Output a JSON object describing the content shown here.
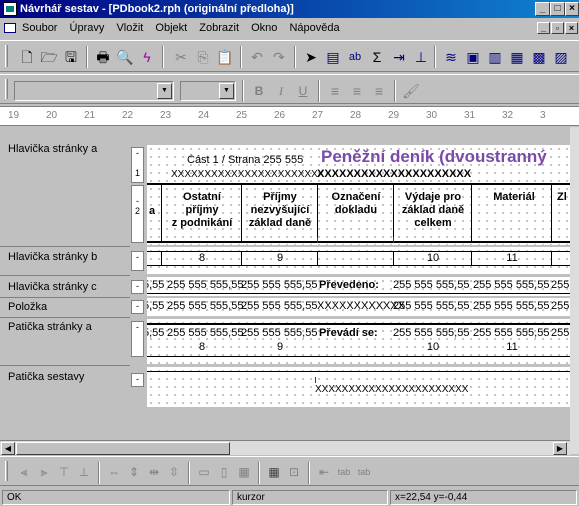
{
  "window": {
    "title": "Návrhář sestav - [PDbook2.rph (originální předloha)]",
    "minimize": "_",
    "maximize": "□",
    "close": "×",
    "mdi_min": "_",
    "mdi_restore": "▫",
    "mdi_close": "×"
  },
  "menu": [
    "Soubor",
    "Úpravy",
    "Vložit",
    "Objekt",
    "Zobrazit",
    "Okno",
    "Nápověda"
  ],
  "toolbar_format": {
    "font_combo": "",
    "size_combo": "",
    "bold": "B",
    "italic": "I",
    "underline": "U"
  },
  "ruler": {
    "ticks": [
      "19",
      "20",
      "21",
      "22",
      "23",
      "24",
      "25",
      "26",
      "27",
      "28",
      "29",
      "30",
      "31",
      "32",
      "3"
    ]
  },
  "sections": [
    {
      "label": "Hlavička stránky a"
    },
    {
      "label": "Hlavička stránky b"
    },
    {
      "label": "Hlavička stránky c"
    },
    {
      "label": "Položka"
    },
    {
      "label": "Patička stránky a"
    },
    {
      "label": "Patička sestavy"
    }
  ],
  "band_buttons": {
    "header_a_1": "-",
    "header_a_1_num": "1",
    "header_a_2": "-",
    "header_a_2_num": "2",
    "header_b": "-",
    "header_c": "-",
    "item": "-",
    "footer_a": "-",
    "footer_report": "-"
  },
  "report": {
    "page_label": "Část 1 / Strana 255 555",
    "big_title": "Peněžní deník (dvoustranný",
    "xfill_small": "XXXXXXXXXXXXXXXXXXXXXXX",
    "xfill_bold": "XXXXXXXXXXXXXXXXXXXXX",
    "col_a": "a",
    "col_ostatni": [
      "Ostatní",
      "příjmy",
      "z podnikání"
    ],
    "col_prijmy": [
      "Příjmy",
      "nezvyšující",
      "základ daně"
    ],
    "col_oznaceni": [
      "Označení",
      "dokladu"
    ],
    "col_vydaje": [
      "Výdaje pro",
      "základ daně",
      "celkem"
    ],
    "col_material": "Materiál",
    "col_z": "Zl",
    "num_8": "8",
    "num_9": "9",
    "num_10": "10",
    "num_11": "11",
    "amount": "255 555 555,55",
    "amount_cut": "5,55",
    "prevedeno": "Převedeno:",
    "xfill_item": "XXXXXXXXXXXX",
    "prevadi_se": "Převádí se:",
    "footer_xfill": "XXXXXXXXXXXXXXXXXXXXXXX"
  },
  "status": {
    "state": "OK",
    "mode": "kurzor",
    "coords": "x=22,54  y=-0,44"
  }
}
